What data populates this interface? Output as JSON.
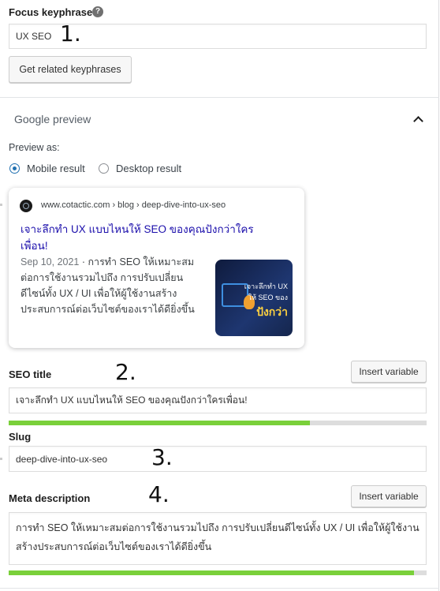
{
  "focus_keyphrase": {
    "label": "Focus keyphrase",
    "help_icon": "question-circle-icon",
    "value": "UX SEO",
    "annotation": "1.",
    "related_button": "Get related keyphrases"
  },
  "google_preview": {
    "section_title": "Google preview",
    "collapse_icon": "chevron-up-icon",
    "preview_as_label": "Preview as:",
    "options": [
      {
        "label": "Mobile result",
        "checked": true
      },
      {
        "label": "Desktop result",
        "checked": false
      }
    ],
    "serp": {
      "url": "www.cotactic.com › blog › deep-dive-into-ux-seo",
      "title_line1": "เจาะลึกทำ UX แบบไหนให้ SEO ของคุณปังกว่าใคร",
      "title_line2": "เพื่อน!",
      "date": "Sep 10, 2021",
      "desc_line1_rest": " · การทำ SEO ให้เหมาะสม",
      "desc_line2": "ต่อการใช้งานรวมไปถึง การปรับเปลี่ยน",
      "desc_line3": "ดีไซน์ทั้ง UX / UI เพื่อให้ผู้ใช้งานสร้าง",
      "desc_line4": "ประสบการณ์ต่อเว็บไซต์ของเราได้ดียิ่งขึ้น",
      "thumb_text1": "เจาะลึกทำ UX",
      "thumb_text2": "ให้ SEO ของ",
      "thumb_text3": "ปังกว่า"
    }
  },
  "seo_title": {
    "label": "SEO title",
    "annotation": "2.",
    "insert_button": "Insert variable",
    "value": "เจาะลึกทำ UX แบบไหนให้ SEO ของคุณปังกว่าใครเพื่อน!",
    "progress": 0.72
  },
  "slug": {
    "label": "Slug",
    "annotation": "3.",
    "value": "deep-dive-into-ux-seo"
  },
  "meta_description": {
    "label": "Meta description",
    "annotation": "4.",
    "insert_button": "Insert variable",
    "line1": "การทำ SEO ให้เหมาะสมต่อการใช้งานรวมไปถึง การปรับเปลี่ยนดีไซน์ทั้ง UX / UI เพื่อให้ผู้ใช้งาน",
    "line2": "สร้างประสบการณ์ต่อเว็บไซต์ของเราได้ดียิ่งขึ้น",
    "progress": 0.97
  }
}
